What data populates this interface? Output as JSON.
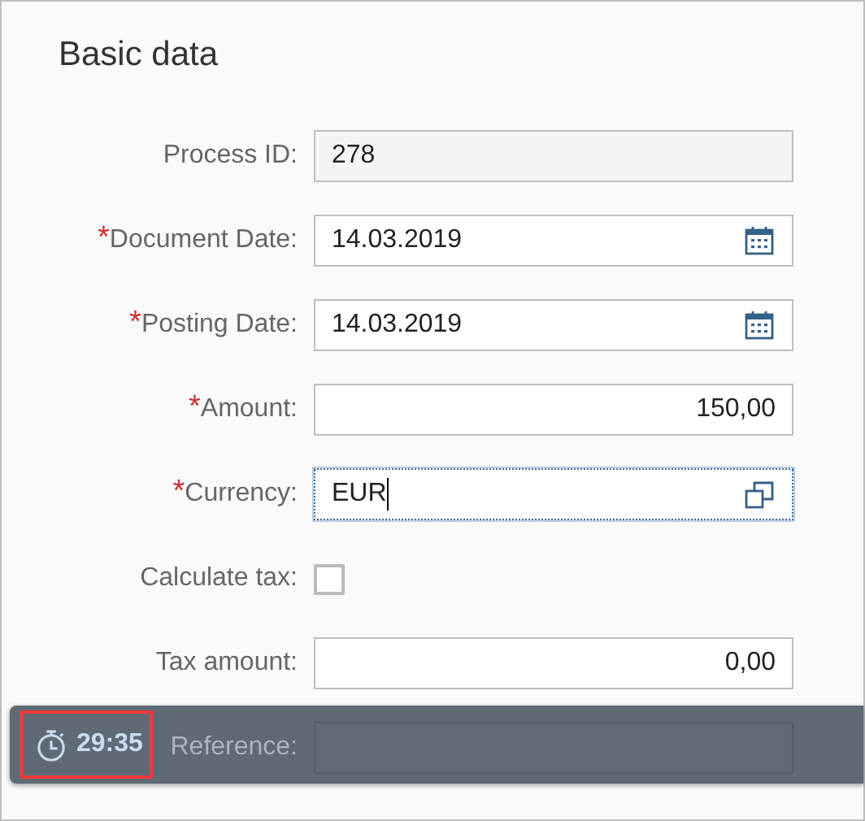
{
  "title": "Basic data",
  "fields": [
    {
      "label": "Process ID:",
      "kind": "readonly",
      "required": false,
      "value": "278"
    },
    {
      "label": "Document Date:",
      "kind": "date",
      "required": true,
      "value": "14.03.2019"
    },
    {
      "label": "Posting Date:",
      "kind": "date",
      "required": true,
      "value": "14.03.2019"
    },
    {
      "label": "Amount:",
      "kind": "number",
      "required": true,
      "value": "150,00"
    },
    {
      "label": "Currency:",
      "kind": "valuehelp",
      "required": true,
      "value": "EUR",
      "focused": true
    },
    {
      "label": "Calculate tax:",
      "kind": "checkbox",
      "required": false,
      "checked": false
    },
    {
      "label": "Tax amount:",
      "kind": "number",
      "required": false,
      "value": "0,00"
    },
    {
      "label": "Reference:",
      "kind": "text",
      "required": false,
      "covered": true
    }
  ],
  "timer_bar": {
    "time": "29:35",
    "highlighted": true
  },
  "required_mark": "*"
}
